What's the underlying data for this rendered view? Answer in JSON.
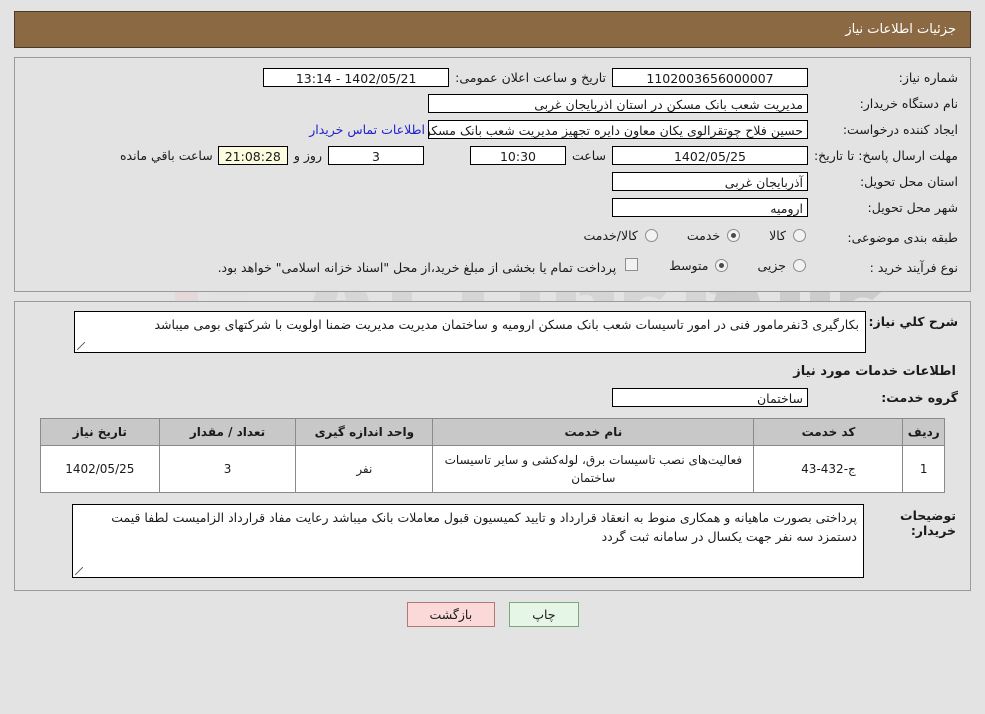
{
  "header": {
    "title": "جزئیات اطلاعات نیاز"
  },
  "form": {
    "need_no_label": "شماره نیاز:",
    "need_no_value": "1102003656000007",
    "announce_label": "تاریخ و ساعت اعلان عمومی:",
    "announce_value": "1402/05/21 - 13:14",
    "buyer_label": "نام دستگاه خریدار:",
    "buyer_value": "مدیریت شعب بانک مسکن در استان اذربایجان غربی",
    "creator_label": "ایجاد کننده درخواست:",
    "creator_value": "حسین فلاح چوتقرالوی یکان معاون دایره تجهیز  مدیریت شعب بانک مسکن در اس",
    "contact_link": "اطلاعات تماس خریدار",
    "deadline_label": "مهلت ارسال پاسخ: تا تاریخ:",
    "deadline_date": "1402/05/25",
    "hour_label": "ساعت",
    "deadline_time": "10:30",
    "days_value": "3",
    "days_label": "روز و",
    "countdown_value": "21:08:28",
    "countdown_label": "ساعت باقي مانده",
    "province_label": "استان محل تحویل:",
    "province_value": "آذربایجان غربی",
    "city_label": "شهر محل تحویل:",
    "city_value": "ارومیه",
    "category_label": "طبقه بندی موضوعی:",
    "category_options": [
      {
        "label": "کالا",
        "selected": false
      },
      {
        "label": "خدمت",
        "selected": true
      },
      {
        "label": "کالا/خدمت",
        "selected": false
      }
    ],
    "process_label": "نوع فرآیند خرید :",
    "process_options": [
      {
        "label": "جزیی",
        "selected": false
      },
      {
        "label": "متوسط",
        "selected": true
      }
    ],
    "treasury_checkbox_checked": false,
    "treasury_note": "پرداخت تمام یا بخشی از مبلغ خرید،از محل \"اسناد خزانه اسلامی\" خواهد بود."
  },
  "description": {
    "label": "شرح کلي نیاز:",
    "value": "بکارگیری 3نفرمامور فنی در امور تاسیسات شعب بانک مسکن ارومیه و ساختمان مدیریت مدیریت ضمنا اولویت با شرکتهای بومی میباشد"
  },
  "services": {
    "section_title": "اطلاعات خدمات مورد نیاز",
    "group_label": "گروه خدمت:",
    "group_value": "ساختمان",
    "columns": [
      "ردیف",
      "کد خدمت",
      "نام خدمت",
      "واحد اندازه گیری",
      "تعداد / مقدار",
      "تاریخ نیاز"
    ],
    "rows": [
      {
        "radif": "1",
        "code": "ج-432-43",
        "name": "فعالیت‌های نصب تاسیسات برق، لوله‌کشی و سایر تاسیسات ساختمان",
        "unit": "نفر",
        "qty": "3",
        "date": "1402/05/25"
      }
    ]
  },
  "notes": {
    "label": "توضیحات خریدار:",
    "value": "پرداختی بصورت ماهیانه و همکاری منوط به انعقاد قرارداد و تایید کمیسیون قبول معاملات بانک میباشد رعایت مفاد قرارداد الزامیست لطفا قیمت دستمزد سه نفر جهت یکسال در سامانه ثبت گردد"
  },
  "buttons": {
    "print": "چاپ",
    "back": "بازگشت"
  },
  "watermark": {
    "text": "AriaTender.net"
  },
  "colors": {
    "header_bg": "#8b6a43",
    "timer_bg": "#fbfbdd",
    "link": "#2222cc",
    "print_btn": "#e6f6e6",
    "back_btn": "#fbd9d9"
  }
}
